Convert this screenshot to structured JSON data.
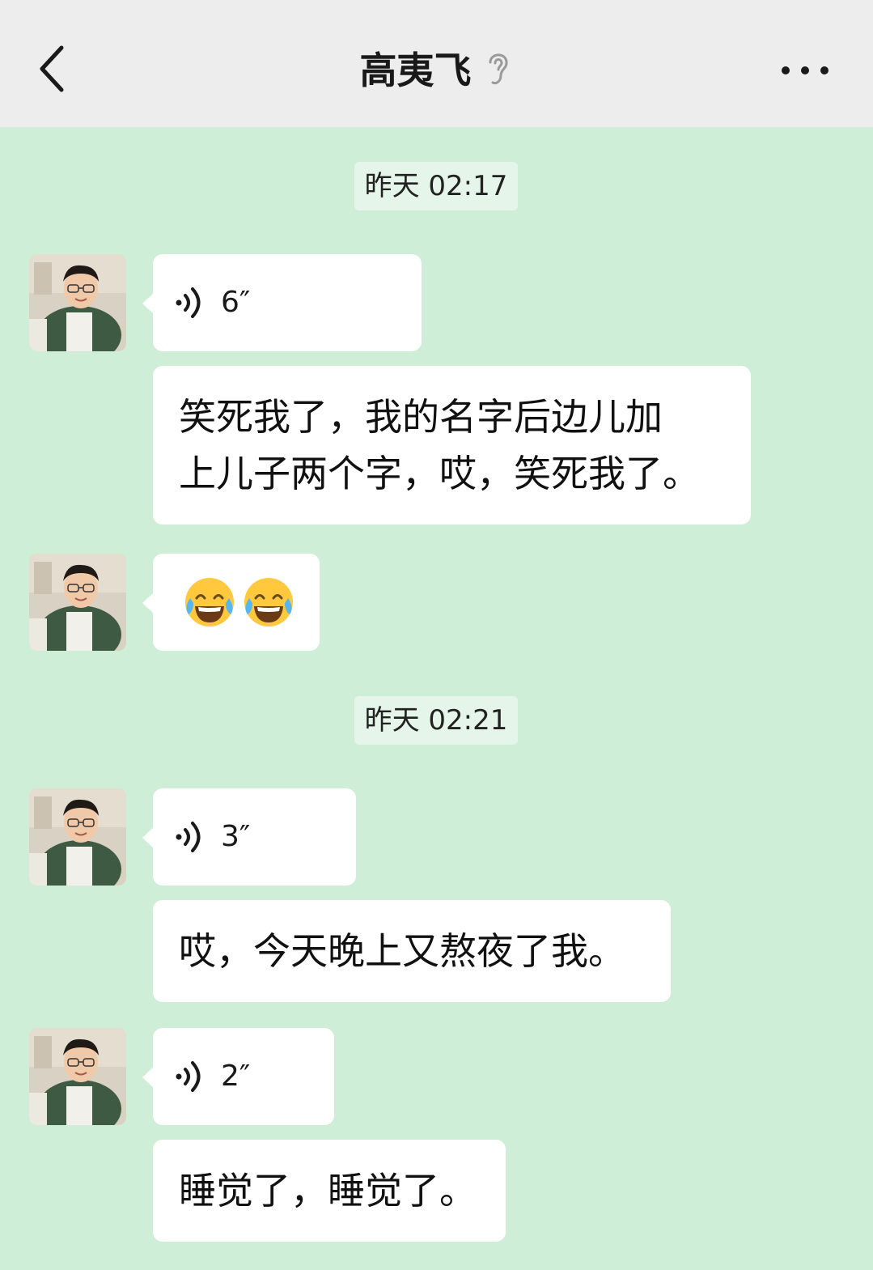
{
  "header": {
    "title": "高夷飞",
    "back_icon": "chevron-left-icon",
    "earpiece_icon": "ear-icon",
    "more_icon": "more-horizontal-icon"
  },
  "messages": [
    {
      "type": "timestamp",
      "text": "昨天 02:17"
    },
    {
      "type": "voice",
      "duration": "6″"
    },
    {
      "type": "text",
      "lines": [
        "笑死我了，我的名字后边儿加",
        "上儿子两个字，哎，笑死我了。"
      ]
    },
    {
      "type": "emoji",
      "emoji_name": "face-with-tears-of-joy",
      "count": 2
    },
    {
      "type": "timestamp",
      "text": "昨天 02:21"
    },
    {
      "type": "voice",
      "duration": "3″"
    },
    {
      "type": "text",
      "lines": [
        "哎，今天晚上又熬夜了我。"
      ]
    },
    {
      "type": "voice",
      "duration": "2″"
    },
    {
      "type": "text",
      "lines": [
        "睡觉了，睡觉了。"
      ]
    }
  ],
  "colors": {
    "chat_background": "#cfeed7",
    "header_background": "#ededed",
    "bubble": "#ffffff",
    "timestamp_background": "#e6f5ea"
  }
}
